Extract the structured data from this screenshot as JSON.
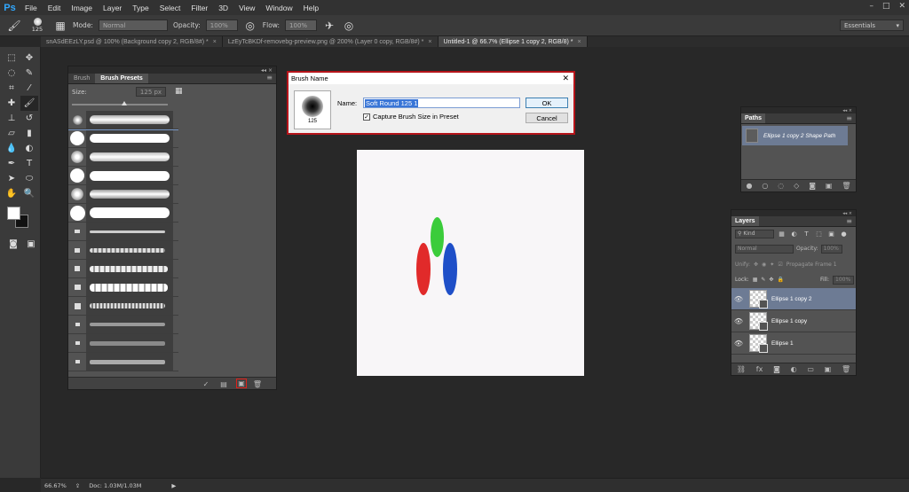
{
  "app": {
    "logo": "Ps"
  },
  "menu": [
    "File",
    "Edit",
    "Image",
    "Layer",
    "Type",
    "Select",
    "Filter",
    "3D",
    "View",
    "Window",
    "Help"
  ],
  "window_controls": [
    "–",
    "□",
    "✕"
  ],
  "options": {
    "brush_size": "125",
    "mode_label": "Mode:",
    "mode_value": "Normal",
    "opacity_label": "Opacity:",
    "opacity_value": "100%",
    "flow_label": "Flow:",
    "flow_value": "100%",
    "workspace": "Essentials"
  },
  "doc_tabs": [
    {
      "label": "snASdEEzLY.psd @ 100% (Background copy 2, RGB/8#) *",
      "active": false
    },
    {
      "label": "LzEyTcBKDf-removebg-preview.png @ 200% (Layer 0 copy, RGB/8#) *",
      "active": false
    },
    {
      "label": "Untitled-1 @ 66.7% (Ellipse 1 copy 2, RGB/8) *",
      "active": true
    }
  ],
  "brush_panel": {
    "tab_brush": "Brush",
    "tab_presets": "Brush Presets",
    "size_label": "Size:",
    "size_value": "125 px"
  },
  "dialog": {
    "title": "Brush Name",
    "close": "✕",
    "preview_size": "125",
    "name_label": "Name:",
    "name_value": "Soft Round 125 1",
    "checkbox_label": "Capture Brush Size in Preset",
    "checkbox_checked": "✓",
    "ok": "OK",
    "cancel": "Cancel"
  },
  "paths_panel": {
    "title": "Paths",
    "item": "Ellipse 1 copy 2 Shape Path"
  },
  "layers_panel": {
    "title": "Layers",
    "kind": "Kind",
    "blend": "Normal",
    "opacity_label": "Opacity:",
    "opacity_value": "100%",
    "unify_label": "Unify:",
    "propagate": "Propagate Frame 1",
    "lock_label": "Lock:",
    "fill_label": "Fill:",
    "fill_value": "100%",
    "layers": [
      {
        "name": "Ellipse 1 copy 2",
        "selected": true
      },
      {
        "name": "Ellipse 1 copy",
        "selected": false
      },
      {
        "name": "Ellipse 1",
        "selected": false
      }
    ]
  },
  "status": {
    "zoom": "66.67%",
    "doc": "Doc: 1.03M/1.03M"
  },
  "colors": {
    "ellipse_red": "#e12a2a",
    "ellipse_green": "#3bcc3b",
    "ellipse_blue": "#1f4fc8",
    "highlight": "#b5141a"
  }
}
